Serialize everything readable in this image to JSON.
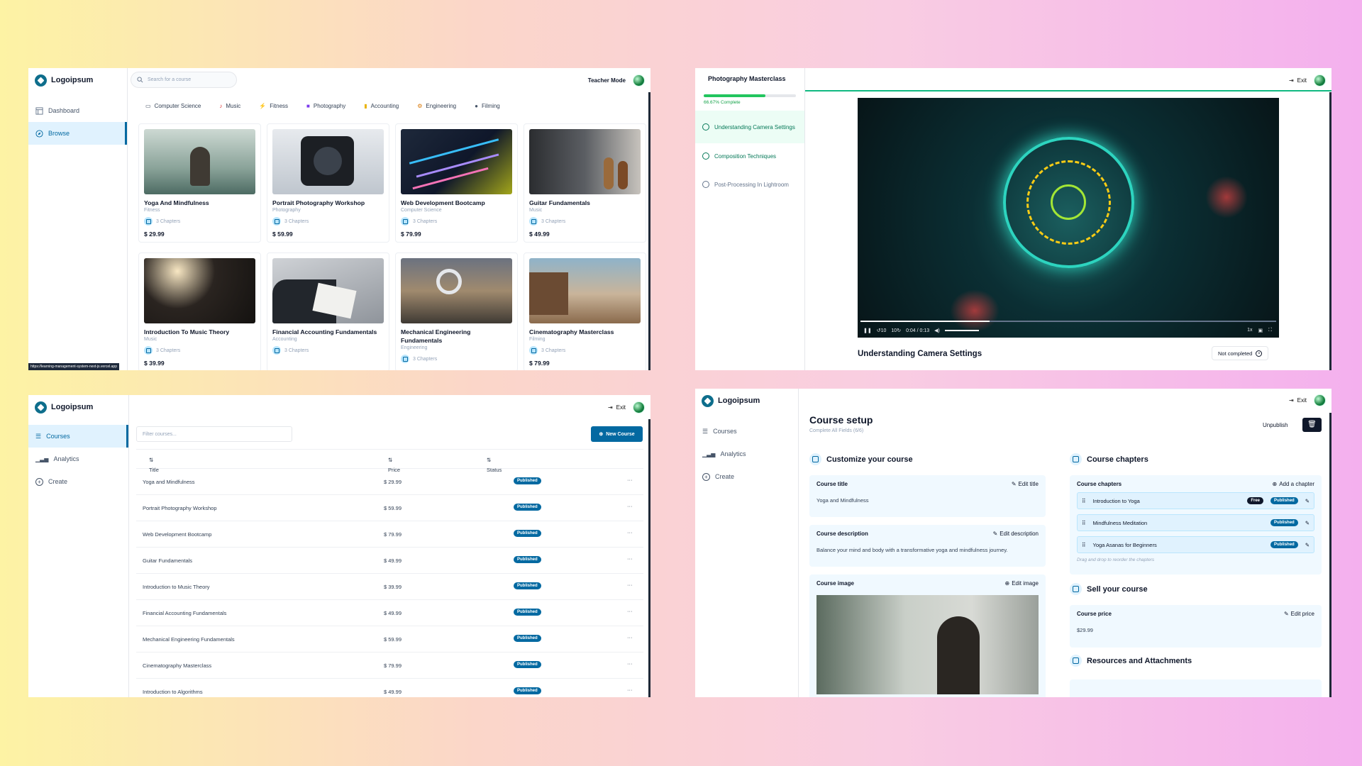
{
  "browse": {
    "logo": "Logoipsum",
    "nav": [
      "Dashboard",
      "Browse"
    ],
    "search_placeholder": "Search for a course",
    "teacher_mode": "Teacher Mode",
    "categories": [
      "Computer Science",
      "Music",
      "Fitness",
      "Photography",
      "Accounting",
      "Engineering",
      "Filming"
    ],
    "courses": [
      {
        "title": "Yoga And Mindfulness",
        "category": "Fitness",
        "chapters": "3 Chapters",
        "price": "$ 29.99"
      },
      {
        "title": "Portrait Photography Workshop",
        "category": "Photography",
        "chapters": "3 Chapters",
        "price": "$ 59.99"
      },
      {
        "title": "Web Development Bootcamp",
        "category": "Computer Science",
        "chapters": "3 Chapters",
        "price": "$ 79.99"
      },
      {
        "title": "Guitar Fundamentals",
        "category": "Music",
        "chapters": "3 Chapters",
        "price": "$ 49.99"
      },
      {
        "title": "Introduction To Music Theory",
        "category": "Music",
        "chapters": "3 Chapters",
        "price": "$ 39.99"
      },
      {
        "title": "Financial Accounting Fundamentals",
        "category": "Accounting",
        "chapters": "3 Chapters",
        "price": ""
      },
      {
        "title": "Mechanical Engineering Fundamentals",
        "category": "Engineering",
        "chapters": "3 Chapters",
        "price": ""
      },
      {
        "title": "Cinematography Masterclass",
        "category": "Filming",
        "chapters": "3 Chapters",
        "price": "$ 79.99"
      }
    ],
    "status_url": "https://learning-management-system-next-js.vercel.app"
  },
  "player": {
    "course_title": "Photography Masterclass",
    "progress_text": "66.67% Complete",
    "progress": 0.6667,
    "exit": "Exit",
    "chapters": [
      "Understanding Camera Settings",
      "Composition Techniques",
      "Post-Processing In Lightroom"
    ],
    "time": "0:04 / 0:13",
    "back": "10",
    "fwd": "10",
    "speed": "1x",
    "video_title": "Understanding Camera Settings",
    "status_button": "Not completed"
  },
  "teacher": {
    "logo": "Logoipsum",
    "nav": [
      "Courses",
      "Analytics",
      "Create"
    ],
    "exit": "Exit",
    "filter_placeholder": "Filter courses...",
    "new_course": "New Course",
    "columns": [
      "Title",
      "Price",
      "Status"
    ],
    "rows": [
      {
        "title": "Yoga and Mindfulness",
        "price": "$ 29.99",
        "status": "Published"
      },
      {
        "title": "Portrait Photography Workshop",
        "price": "$ 59.99",
        "status": "Published"
      },
      {
        "title": "Web Development Bootcamp",
        "price": "$ 79.99",
        "status": "Published"
      },
      {
        "title": "Guitar Fundamentals",
        "price": "$ 49.99",
        "status": "Published"
      },
      {
        "title": "Introduction to Music Theory",
        "price": "$ 39.99",
        "status": "Published"
      },
      {
        "title": "Financial Accounting Fundamentals",
        "price": "$ 49.99",
        "status": "Published"
      },
      {
        "title": "Mechanical Engineering Fundamentals",
        "price": "$ 59.99",
        "status": "Published"
      },
      {
        "title": "Cinematography Masterclass",
        "price": "$ 79.99",
        "status": "Published"
      },
      {
        "title": "Introduction to Algorithms",
        "price": "$ 49.99",
        "status": "Published"
      }
    ],
    "more": "···"
  },
  "setup": {
    "logo": "Logoipsum",
    "nav": [
      "Courses",
      "Analytics",
      "Create"
    ],
    "exit": "Exit",
    "title": "Course setup",
    "subtitle": "Complete All Fields (6/6)",
    "unpublish": "Unpublish",
    "customize": "Customize your course",
    "course_title_label": "Course title",
    "edit_title": "Edit title",
    "course_title_value": "Yoga and Mindfulness",
    "desc_label": "Course description",
    "edit_desc": "Edit description",
    "desc_value": "Balance your mind and body with a transformative yoga and mindfulness journey.",
    "image_label": "Course image",
    "edit_image": "Edit image",
    "chapters_section": "Course chapters",
    "chapters_label": "Course chapters",
    "add_chapter": "Add a chapter",
    "chapters": [
      {
        "title": "Introduction to Yoga",
        "free": "Free",
        "status": "Published"
      },
      {
        "title": "Mindfulness Meditation",
        "status": "Published"
      },
      {
        "title": "Yoga Asanas for Beginners",
        "status": "Published"
      }
    ],
    "drag_hint": "Drag and drop to reorder the chapters",
    "sell": "Sell your course",
    "price_label": "Course price",
    "edit_price": "Edit price",
    "price_value": "$29.99",
    "resources": "Resources and Attachments"
  }
}
